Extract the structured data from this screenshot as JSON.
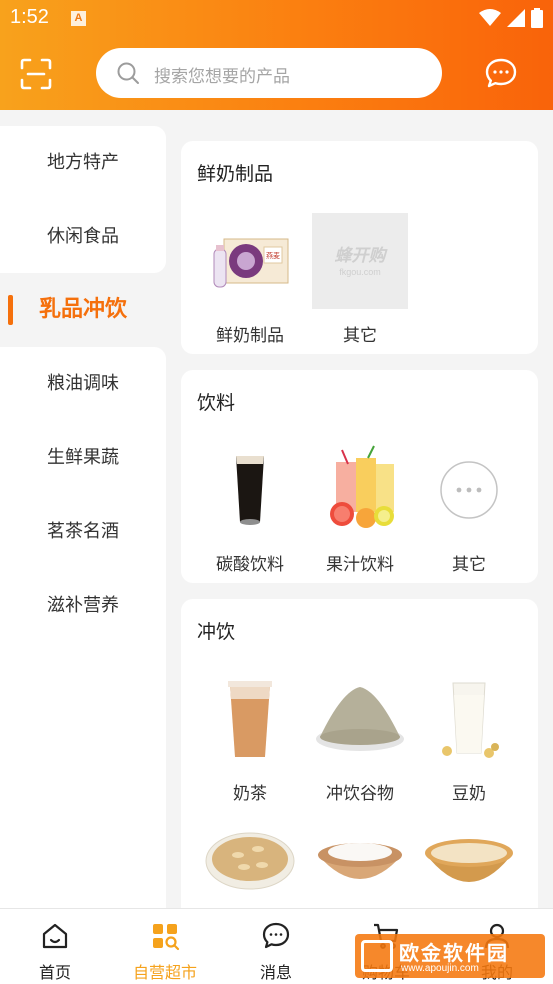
{
  "status": {
    "time": "1:52",
    "a_badge": "A"
  },
  "search": {
    "placeholder": "搜索您想要的产品"
  },
  "sidebar": {
    "items": [
      {
        "label": "地方特产"
      },
      {
        "label": "休闲食品"
      },
      {
        "label": "乳品冲饮"
      },
      {
        "label": "粮油调味"
      },
      {
        "label": "生鲜果蔬"
      },
      {
        "label": "茗茶名酒"
      },
      {
        "label": "滋补营养"
      }
    ],
    "active_index": 2
  },
  "sections": [
    {
      "title": "鲜奶制品",
      "items": [
        {
          "label": "鲜奶制品",
          "icon": "milk-box"
        },
        {
          "label": "其它",
          "icon": "placeholder-logo"
        }
      ]
    },
    {
      "title": "饮料",
      "items": [
        {
          "label": "碳酸饮料",
          "icon": "dark-soda-glass"
        },
        {
          "label": "果汁饮料",
          "icon": "juice-glasses"
        },
        {
          "label": "其它",
          "icon": "more-circle"
        }
      ]
    },
    {
      "title": "冲饮",
      "items": [
        {
          "label": "奶茶",
          "icon": "milk-tea-cup"
        },
        {
          "label": "冲饮谷物",
          "icon": "grain-powder"
        },
        {
          "label": "豆奶",
          "icon": "soy-milk-glass"
        },
        {
          "label": "",
          "icon": "oats-plate"
        },
        {
          "label": "",
          "icon": "flour-bowl"
        },
        {
          "label": "",
          "icon": "soy-drink-bowl"
        }
      ]
    }
  ],
  "placeholder_logo": {
    "text": "蜂开购",
    "url": "fkgou.com"
  },
  "tabbar": {
    "items": [
      {
        "label": "首页"
      },
      {
        "label": "自营超市"
      },
      {
        "label": "消息"
      },
      {
        "label": "购物车"
      },
      {
        "label": "我的"
      }
    ],
    "active_index": 1
  },
  "watermark": {
    "text": "欧金软件园",
    "url": "www.apoujin.com"
  },
  "colors": {
    "accent": "#f5700c",
    "header_start": "#f8a21c",
    "header_end": "#f9630a",
    "tab_active": "#f5a21c"
  }
}
